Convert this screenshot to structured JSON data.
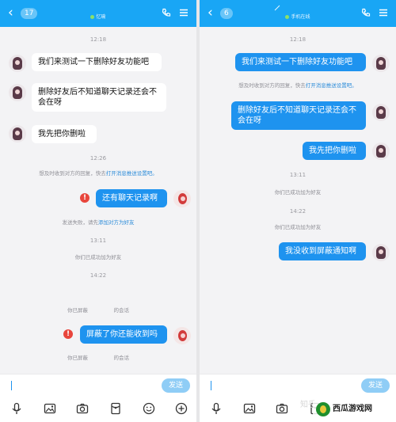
{
  "left": {
    "header": {
      "back_label": "‹",
      "badge": "17",
      "title": "忆瑜",
      "status_color": "#8be06a"
    },
    "messages": [
      {
        "type": "time",
        "text": "12:18"
      },
      {
        "type": "in",
        "text": "我们来测试一下删除好友功能吧"
      },
      {
        "type": "in",
        "text": "删除好友后不知道聊天记录还会不会在呀"
      },
      {
        "type": "in",
        "text": "我先把你删啦"
      },
      {
        "type": "time",
        "text": "12:26"
      },
      {
        "type": "notice",
        "before": "想及时收到对方的回复，快去",
        "link": "打开消息推送设置吧。",
        "after": ""
      },
      {
        "type": "out_failed",
        "text": "还有聊天记录啊"
      },
      {
        "type": "notice",
        "before": "发送失败，请先",
        "link": "添加对方为好友",
        "after": ""
      },
      {
        "type": "time",
        "text": "13:11"
      },
      {
        "type": "system",
        "text": "你们已成功加为好友"
      },
      {
        "type": "time",
        "text": "14:22"
      },
      {
        "type": "system",
        "text": "你已屏蔽　　　　　的会话"
      },
      {
        "type": "out_failed",
        "text": "屏蔽了你还能收到吗"
      },
      {
        "type": "system",
        "text": "你已屏蔽　　　　　的会话"
      }
    ],
    "input": {
      "placeholder": "",
      "send_label": "发送"
    }
  },
  "right": {
    "header": {
      "back_label": "‹",
      "badge": "6",
      "title": "手机在线",
      "status_color": "#8be06a"
    },
    "messages": [
      {
        "type": "time",
        "text": "12:18"
      },
      {
        "type": "out",
        "text": "我们来测试一下删除好友功能吧"
      },
      {
        "type": "notice",
        "before": "想及时收到对方的回复，快去",
        "link": "打开消息推送设置吧。",
        "after": ""
      },
      {
        "type": "out",
        "text": "删除好友后不知道聊天记录还会不会在呀"
      },
      {
        "type": "out",
        "text": "我先把你删啦"
      },
      {
        "type": "time",
        "text": "13:11"
      },
      {
        "type": "system",
        "text": "你们已成功加为好友"
      },
      {
        "type": "time",
        "text": "14:22"
      },
      {
        "type": "system",
        "text": "你们已成功加为好友"
      },
      {
        "type": "out",
        "text": "我没收到屏蔽通知啊"
      }
    ],
    "input": {
      "placeholder": "",
      "send_label": "发送"
    }
  },
  "toolbar_icons": [
    "mic-icon",
    "image-icon",
    "camera-icon",
    "red-packet-icon",
    "emoji-icon",
    "plus-icon"
  ],
  "watermark": {
    "text": "西瓜游戏网",
    "faint": "知乎 @"
  },
  "colors": {
    "header_blue": "#19a6f5",
    "bubble_blue": "#1e93ef",
    "error_red": "#e8453c",
    "link_blue": "#2d8cd9"
  }
}
